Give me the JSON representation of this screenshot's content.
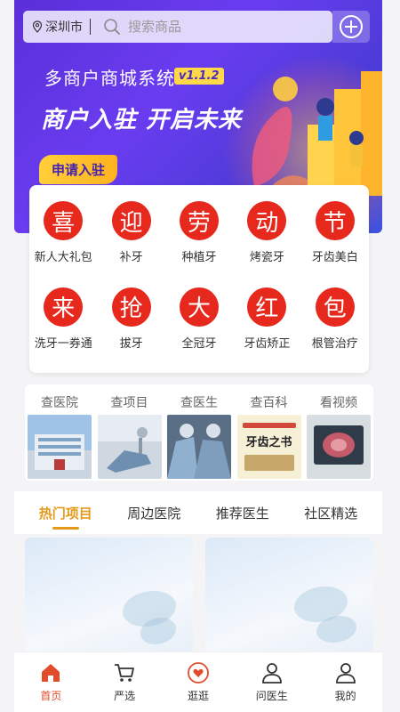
{
  "header": {
    "city": "深圳市",
    "search_placeholder": "搜索商品",
    "add_icon": "plus-circle-icon"
  },
  "banner": {
    "title": "多商户商城系统",
    "version": "v1.1.2",
    "slogan": "商户入驻  开启未来",
    "apply_button": "申请入驻"
  },
  "categories": [
    {
      "char": "喜",
      "label": "新人大礼包"
    },
    {
      "char": "迎",
      "label": "补牙"
    },
    {
      "char": "劳",
      "label": "种植牙"
    },
    {
      "char": "动",
      "label": "烤瓷牙"
    },
    {
      "char": "节",
      "label": "牙齿美白"
    },
    {
      "char": "来",
      "label": "洗牙一券通"
    },
    {
      "char": "抢",
      "label": "拔牙"
    },
    {
      "char": "大",
      "label": "全冠牙"
    },
    {
      "char": "红",
      "label": "牙齿矫正"
    },
    {
      "char": "包",
      "label": "根管治疗"
    }
  ],
  "quick_links": [
    {
      "label": "查医院"
    },
    {
      "label": "查项目"
    },
    {
      "label": "查医生"
    },
    {
      "label": "查百科",
      "thumb_text": "牙齿之书"
    },
    {
      "label": "看视频"
    }
  ],
  "tabs": [
    {
      "label": "热门项目",
      "active": true
    },
    {
      "label": "周边医院"
    },
    {
      "label": "推荐医生"
    },
    {
      "label": "社区精选"
    }
  ],
  "bottom_nav": [
    {
      "label": "首页",
      "icon": "home-icon",
      "active": true
    },
    {
      "label": "严选",
      "icon": "cart-icon"
    },
    {
      "label": "逛逛",
      "icon": "heart-chat-icon"
    },
    {
      "label": "问医生",
      "icon": "user-icon"
    },
    {
      "label": "我的",
      "icon": "profile-icon"
    }
  ],
  "colors": {
    "accent": "#e7281d",
    "tab_active": "#e39a1b",
    "nav_active": "#e24c2b",
    "banner_purple": "#5a2fd8"
  }
}
